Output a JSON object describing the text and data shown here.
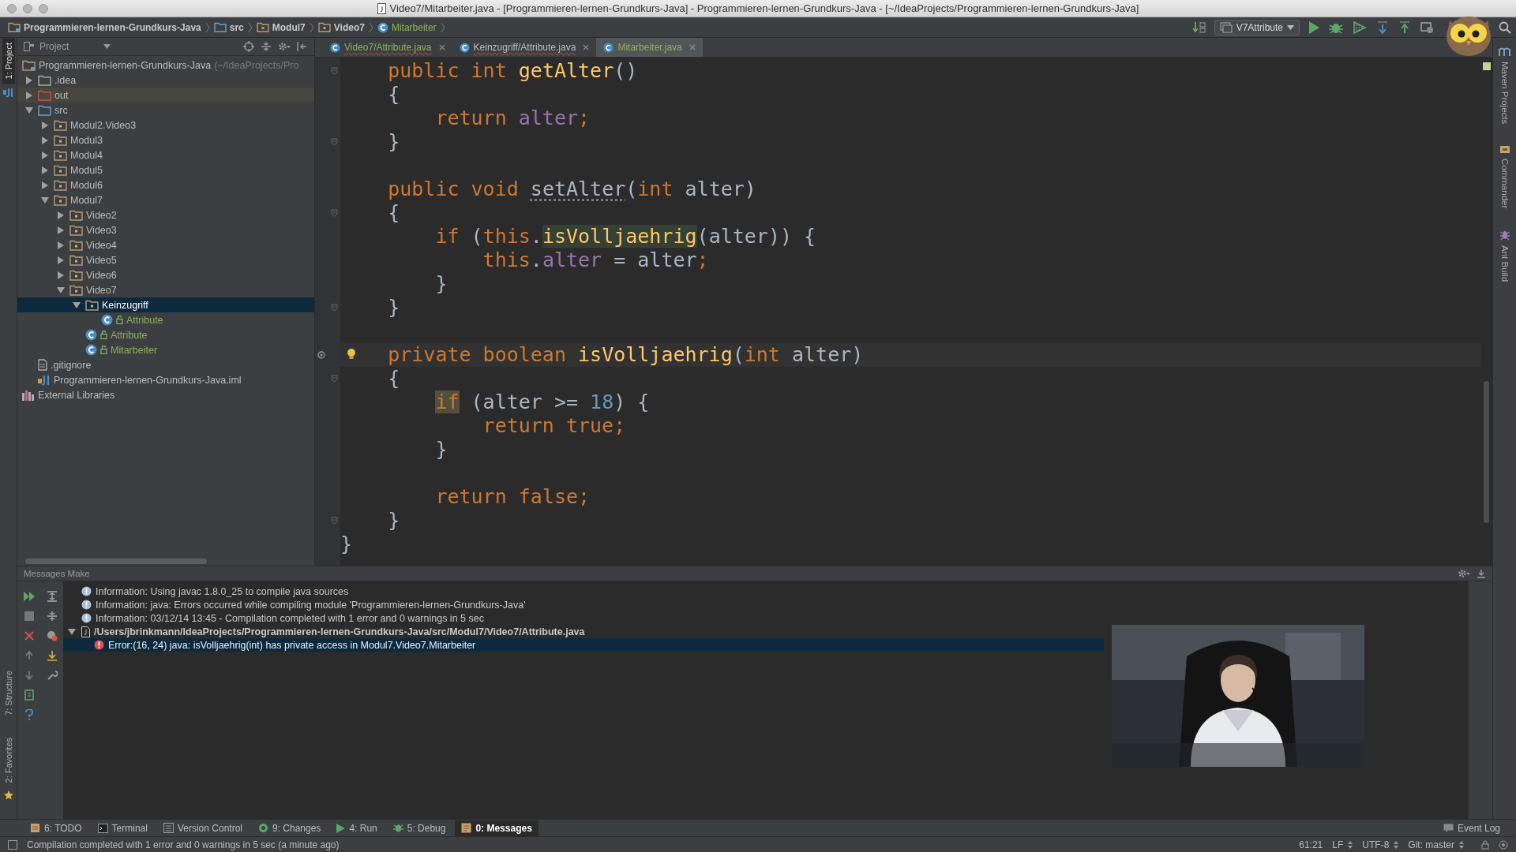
{
  "window": {
    "title": "Video7/Mitarbeiter.java - [Programmieren-lernen-Grundkurs-Java] - Programmieren-lernen-Grundkurs-Java - [~/IdeaProjects/Programmieren-lernen-Grundkurs-Java]"
  },
  "nav": {
    "breadcrumbs": [
      {
        "label": "Programmieren-lernen-Grundkurs-Java",
        "kind": "project"
      },
      {
        "label": "src",
        "kind": "source"
      },
      {
        "label": "Modul7",
        "kind": "package"
      },
      {
        "label": "Video7",
        "kind": "package"
      },
      {
        "label": "Mitarbeiter",
        "kind": "class"
      }
    ],
    "run_config": "V7Attribute"
  },
  "left_strip": [
    {
      "label": "1: Project",
      "selected": true
    },
    {
      "label": "7: Structure",
      "selected": false
    },
    {
      "label": "2: Favorites",
      "selected": false
    }
  ],
  "right_strip": [
    "Maven Projects",
    "Commander",
    "Ant Build"
  ],
  "project": {
    "title": "Project",
    "tree": [
      {
        "label": "Programmieren-lernen-Grundkurs-Java",
        "hint": "(~/IdeaProjects/Pro",
        "kind": "project",
        "selected": false,
        "children": [
          {
            "label": ".idea",
            "kind": "folder",
            "expanded": false,
            "selected": false
          },
          {
            "label": "out",
            "kind": "excluded",
            "expanded": false,
            "selected": false
          },
          {
            "label": "src",
            "kind": "source",
            "expanded": true,
            "selected": false,
            "children": [
              {
                "label": "Modul2.Video3",
                "kind": "package",
                "expanded": false,
                "selected": false
              },
              {
                "label": "Modul3",
                "kind": "package",
                "expanded": false,
                "selected": false
              },
              {
                "label": "Modul4",
                "kind": "package",
                "expanded": false,
                "selected": false
              },
              {
                "label": "Modul5",
                "kind": "package",
                "expanded": false,
                "selected": false
              },
              {
                "label": "Modul6",
                "kind": "package",
                "expanded": false,
                "selected": false
              },
              {
                "label": "Modul7",
                "kind": "package",
                "expanded": true,
                "selected": false,
                "children": [
                  {
                    "label": "Video2",
                    "kind": "package",
                    "expanded": false,
                    "selected": false
                  },
                  {
                    "label": "Video3",
                    "kind": "package",
                    "expanded": false,
                    "selected": false
                  },
                  {
                    "label": "Video4",
                    "kind": "package",
                    "expanded": false,
                    "selected": false
                  },
                  {
                    "label": "Video5",
                    "kind": "package",
                    "expanded": false,
                    "selected": false
                  },
                  {
                    "label": "Video6",
                    "kind": "package",
                    "expanded": false,
                    "selected": false
                  },
                  {
                    "label": "Video7",
                    "kind": "package",
                    "expanded": true,
                    "selected": false,
                    "children": [
                      {
                        "label": "Keinzugriff",
                        "kind": "package",
                        "expanded": true,
                        "selected": true,
                        "children": [
                          {
                            "label": "Attribute",
                            "kind": "class",
                            "selected": false
                          }
                        ]
                      },
                      {
                        "label": "Attribute",
                        "kind": "class",
                        "selected": false
                      },
                      {
                        "label": "Mitarbeiter",
                        "kind": "class",
                        "selected": false
                      }
                    ]
                  }
                ]
              }
            ]
          },
          {
            "label": ".gitignore",
            "kind": "file",
            "selected": false
          },
          {
            "label": "Programmieren-lernen-Grundkurs-Java.iml",
            "kind": "module",
            "selected": false
          }
        ]
      },
      {
        "label": "External Libraries",
        "kind": "libraries",
        "selected": false
      }
    ]
  },
  "editor": {
    "tabs": [
      {
        "label": "Video7/Attribute.java",
        "color": "#8fb05a",
        "selected": false
      },
      {
        "label": "Keinzugriff/Attribute.java",
        "color": "#bbbbbb",
        "selected": false
      },
      {
        "label": "Mitarbeiter.java",
        "color": "#8fb05a",
        "selected": true
      }
    ],
    "lines": [
      {
        "kind": "indent1",
        "fold": true,
        "marker": false,
        "current": false,
        "tokens": [
          {
            "text": "public int ",
            "kind": "keyword"
          },
          {
            "text": "getAlter",
            "kind": "method"
          },
          {
            "text": "()",
            "kind": "plain"
          }
        ]
      },
      {
        "kind": "indent1",
        "fold": false,
        "marker": false,
        "current": false,
        "tokens": [
          {
            "text": "{",
            "kind": "plain"
          }
        ]
      },
      {
        "kind": "indent2",
        "fold": false,
        "marker": false,
        "current": false,
        "tokens": [
          {
            "text": "return ",
            "kind": "keyword"
          },
          {
            "text": "alter",
            "kind": "field"
          },
          {
            "text": ";",
            "kind": "keyword"
          }
        ]
      },
      {
        "kind": "indent1",
        "fold": true,
        "marker": false,
        "current": false,
        "tokens": [
          {
            "text": "}",
            "kind": "plain"
          }
        ]
      },
      {
        "kind": "blank"
      },
      {
        "kind": "indent1",
        "fold": false,
        "marker": false,
        "current": false,
        "tokens": [
          {
            "text": "public void ",
            "kind": "keyword"
          },
          {
            "text": "setAlter",
            "kind": "unused"
          },
          {
            "text": "(",
            "kind": "plain"
          },
          {
            "text": "int ",
            "kind": "keyword"
          },
          {
            "text": "alter)",
            "kind": "plain"
          }
        ]
      },
      {
        "kind": "indent1",
        "fold": true,
        "marker": false,
        "current": false,
        "tokens": [
          {
            "text": "{",
            "kind": "plain"
          }
        ]
      },
      {
        "kind": "indent2",
        "fold": false,
        "marker": false,
        "current": false,
        "tokens": [
          {
            "text": "if ",
            "kind": "keyword"
          },
          {
            "text": "(",
            "kind": "plain"
          },
          {
            "text": "this",
            "kind": "keyword"
          },
          {
            "text": ".",
            "kind": "plain"
          },
          {
            "text": "isVolljaehrig",
            "kind": "usage"
          },
          {
            "text": "(alter)) {",
            "kind": "plain"
          }
        ]
      },
      {
        "kind": "indent3",
        "fold": false,
        "marker": false,
        "current": false,
        "tokens": [
          {
            "text": "this",
            "kind": "keyword"
          },
          {
            "text": ".",
            "kind": "plain"
          },
          {
            "text": "alter",
            "kind": "field"
          },
          {
            "text": " = alter",
            "kind": "plain"
          },
          {
            "text": ";",
            "kind": "keyword"
          }
        ]
      },
      {
        "kind": "indent2",
        "fold": false,
        "marker": false,
        "current": false,
        "tokens": [
          {
            "text": "}",
            "kind": "plain"
          }
        ]
      },
      {
        "kind": "indent1",
        "fold": true,
        "marker": false,
        "current": false,
        "tokens": [
          {
            "text": "}",
            "kind": "plain"
          }
        ]
      },
      {
        "kind": "blank"
      },
      {
        "kind": "indent1",
        "fold": false,
        "marker": true,
        "current": true,
        "tokens": [
          {
            "text": "private boolean ",
            "kind": "keyword"
          },
          {
            "text": "isVolljaehrig",
            "kind": "method"
          },
          {
            "text": "(",
            "kind": "plain"
          },
          {
            "text": "int ",
            "kind": "keyword"
          },
          {
            "text": "alter)",
            "kind": "plain"
          }
        ]
      },
      {
        "kind": "indent1",
        "fold": true,
        "marker": false,
        "current": false,
        "tokens": [
          {
            "text": "{",
            "kind": "plain"
          }
        ]
      },
      {
        "kind": "indent2",
        "fold": false,
        "marker": false,
        "current": false,
        "tokens": [
          {
            "text": "if",
            "kind": "match"
          },
          {
            "text": " (alter >= ",
            "kind": "plain"
          },
          {
            "text": "18",
            "kind": "number"
          },
          {
            "text": ") {",
            "kind": "plain"
          }
        ]
      },
      {
        "kind": "indent3",
        "fold": false,
        "marker": false,
        "current": false,
        "tokens": [
          {
            "text": "return true;",
            "kind": "keyword"
          }
        ]
      },
      {
        "kind": "indent2",
        "fold": false,
        "marker": false,
        "current": false,
        "tokens": [
          {
            "text": "}",
            "kind": "plain"
          }
        ]
      },
      {
        "kind": "blank"
      },
      {
        "kind": "indent2",
        "fold": false,
        "marker": false,
        "current": false,
        "tokens": [
          {
            "text": "return false;",
            "kind": "keyword"
          }
        ]
      },
      {
        "kind": "indent1",
        "fold": true,
        "marker": false,
        "current": false,
        "tokens": [
          {
            "text": "}",
            "kind": "plain"
          }
        ]
      },
      {
        "kind": "flush",
        "fold": false,
        "marker": false,
        "current": false,
        "tokens": [
          {
            "text": "}",
            "kind": "plain"
          }
        ]
      }
    ]
  },
  "messages": {
    "title": "Messages Make",
    "rows": [
      {
        "kind": "info",
        "text": "Information: Using javac 1.8.0_25 to compile java sources",
        "selected": false
      },
      {
        "kind": "info",
        "text": "Information: java: Errors occurred while compiling module 'Programmieren-lernen-Grundkurs-Java'",
        "selected": false
      },
      {
        "kind": "info",
        "text": "Information: 03/12/14 13:45 - Compilation completed with 1 error and 0 warnings in 5 sec",
        "selected": false
      },
      {
        "kind": "file",
        "text": "/Users/jbrinkmann/IdeaProjects/Programmieren-lernen-Grundkurs-Java/src/Modul7/Video7/Attribute.java",
        "expanded": true,
        "selected": false,
        "children": [
          {
            "kind": "error",
            "text": "Error:(16, 24)  java: isVolljaehrig(int) has private access in Modul7.Video7.Mitarbeiter",
            "selected": true
          }
        ]
      }
    ]
  },
  "tool_tabs": [
    {
      "label": "6: TODO",
      "kind": "todo",
      "selected": false
    },
    {
      "label": "Terminal",
      "kind": "terminal",
      "selected": false
    },
    {
      "label": "Version Control",
      "kind": "vcs",
      "selected": false
    },
    {
      "label": "9: Changes",
      "kind": "changes",
      "selected": false
    },
    {
      "label": "4: Run",
      "kind": "run",
      "selected": false
    },
    {
      "label": "5: Debug",
      "kind": "debug",
      "selected": false
    },
    {
      "label": "0: Messages",
      "kind": "messages",
      "selected": true
    }
  ],
  "event_log": "Event Log",
  "status_bar": {
    "message": "Compilation completed with 1 error and 0 warnings in 5 sec (a minute ago)",
    "position": "61:21",
    "line_separator": "LF",
    "encoding": "UTF-8",
    "vcs": "Git: master"
  },
  "webcam": {
    "kind": "picture"
  }
}
